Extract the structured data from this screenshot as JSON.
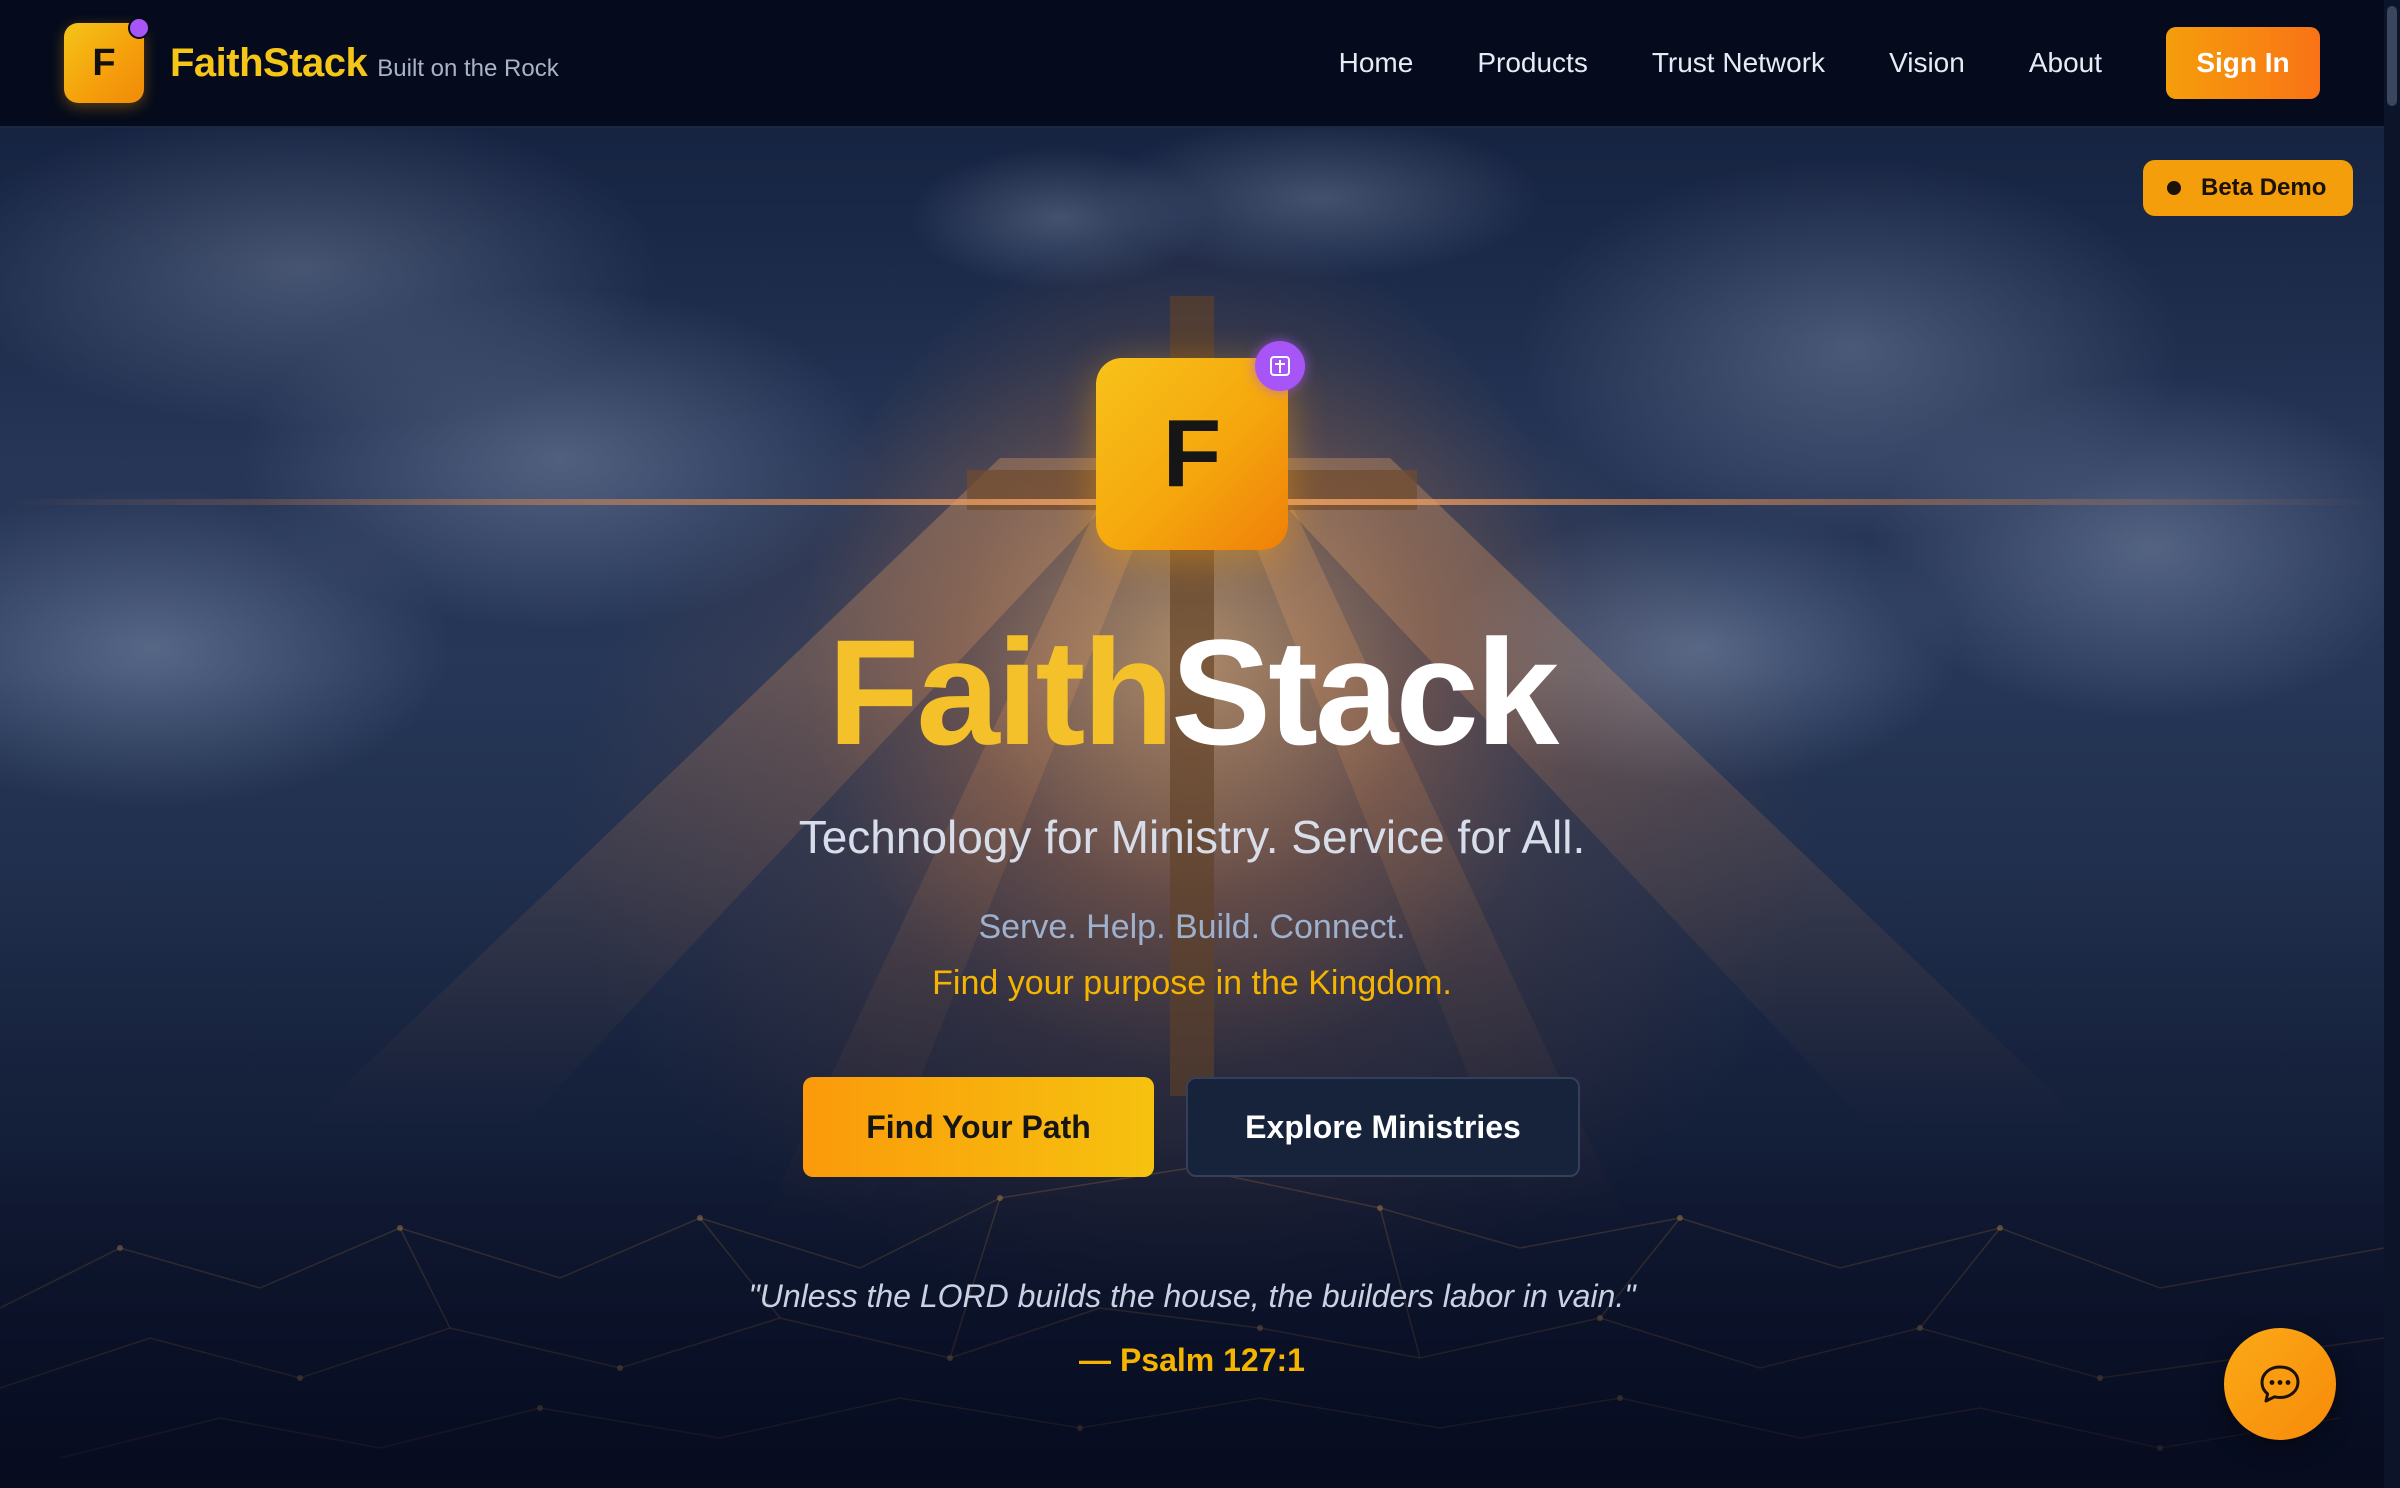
{
  "header": {
    "logo_letter": "F",
    "brand_name": "FaithStack",
    "brand_tagline": "Built on the Rock",
    "nav": [
      "Home",
      "Products",
      "Trust Network",
      "Vision",
      "About"
    ],
    "signin_label": "Sign In"
  },
  "badge": {
    "label": "Beta Demo"
  },
  "hero": {
    "logo_letter": "F",
    "badge_icon": "cross-icon",
    "title_part1": "Faith",
    "title_part2": "Stack",
    "subtitle": "Technology for Ministry. Service for All.",
    "line1": "Serve. Help. Build. Connect.",
    "line2": "Find your purpose in the Kingdom.",
    "primary_button": "Find Your Path",
    "secondary_button": "Explore Ministries",
    "quote": "\"Unless the LORD builds the house, the builders labor in vain.\"",
    "quote_ref": "— Psalm 127:1"
  },
  "chat": {
    "icon": "chat-bubble-icon"
  },
  "colors": {
    "accent": "#f59e0b",
    "gold": "#f5c12b",
    "purple": "#a855f7",
    "header_bg": "#050b1c"
  }
}
